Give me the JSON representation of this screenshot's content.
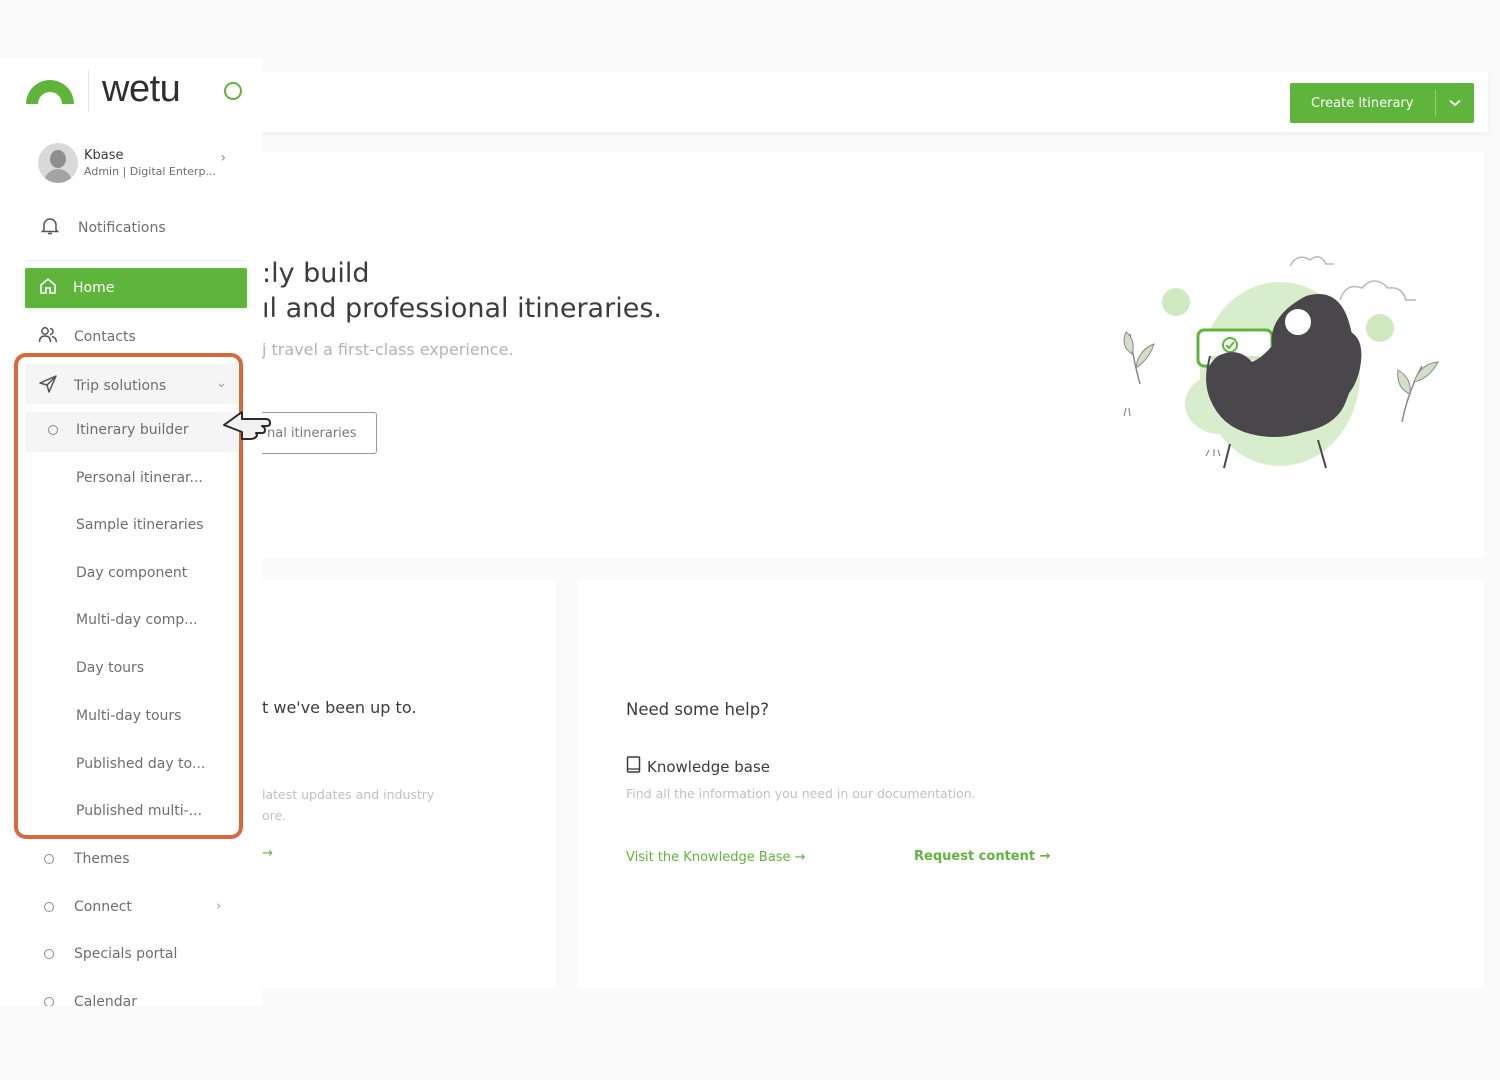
{
  "brand": {
    "logo_text": "wetu",
    "accent_color": "#5fb53c",
    "highlight_color": "#d8693a"
  },
  "profile": {
    "name": "Kbase",
    "role": "Admin | Digital Enterp..."
  },
  "sidebar": {
    "notifications": "Notifications",
    "home": "Home",
    "contacts": "Contacts",
    "trip_solutions": "Trip solutions",
    "itinerary_builder": "Itinerary builder",
    "sub_items": [
      "Personal itinerar...",
      "Sample itineraries",
      "Day component",
      "Multi-day comp...",
      "Day tours",
      "Multi-day tours",
      "Published day to...",
      "Published multi-..."
    ],
    "themes": "Themes",
    "connect": "Connect",
    "specials_portal": "Specials portal",
    "calendar": "Calendar"
  },
  "header": {
    "create_button": "Create Itinerary"
  },
  "hero": {
    "title_line1": ":ly build",
    "title_line2": "ıl and professional itineraries.",
    "subtitle": "j travel a first-class experience.",
    "button": "nal itineraries"
  },
  "updates_card": {
    "title": "t we've been up to.",
    "desc_line1": "latest updates and industry",
    "desc_line2": "ore.",
    "link_arrow": "→"
  },
  "help_card": {
    "title": "Need some help?",
    "kb_title": "Knowledge base",
    "kb_desc": "Find all the information you need in our documentation.",
    "visit_link": "Visit the Knowledge Base  →",
    "request_link": "Request content →"
  },
  "icons": {
    "notifications": "bell-icon",
    "home": "home-icon",
    "contacts": "users-icon",
    "trip_solutions": "paper-plane-icon",
    "knowledge_base": "book-icon",
    "create_dropdown": "chevron-down-icon"
  }
}
